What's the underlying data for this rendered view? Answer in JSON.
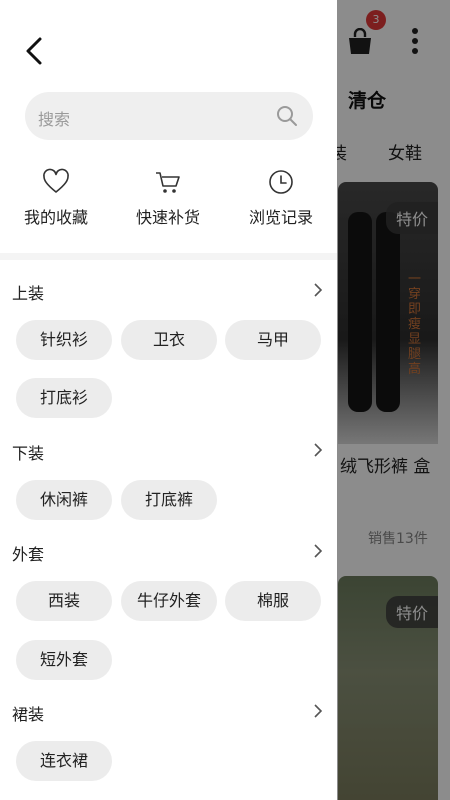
{
  "background": {
    "cart_badge": "3",
    "title": "清仓",
    "tabs": [
      "装",
      "女鞋"
    ],
    "products": [
      {
        "tag": "特价",
        "name": "绒飞形裤 盒",
        "sales": "销售13件",
        "image_text": "一穿即瘦 显腿高"
      },
      {
        "tag": "特价"
      }
    ]
  },
  "drawer": {
    "search": {
      "placeholder": "搜索"
    },
    "quick_links": [
      {
        "label": "我的收藏",
        "icon": "heart-icon"
      },
      {
        "label": "快速补货",
        "icon": "cart-icon"
      },
      {
        "label": "浏览记录",
        "icon": "clock-icon"
      }
    ],
    "categories": [
      {
        "title": "上装",
        "items": [
          "针织衫",
          "卫衣",
          "马甲",
          "打底衫"
        ]
      },
      {
        "title": "下装",
        "items": [
          "休闲裤",
          "打底裤"
        ]
      },
      {
        "title": "外套",
        "items": [
          "西装",
          "牛仔外套",
          "棉服",
          "短外套"
        ]
      },
      {
        "title": "裙装",
        "items": [
          "连衣裙"
        ]
      }
    ]
  },
  "colors": {
    "badge": "#e23a3a",
    "chip_bg": "#ececec",
    "search_bg": "#efefef",
    "overlay": "rgba(0,0,0,0.45)"
  }
}
